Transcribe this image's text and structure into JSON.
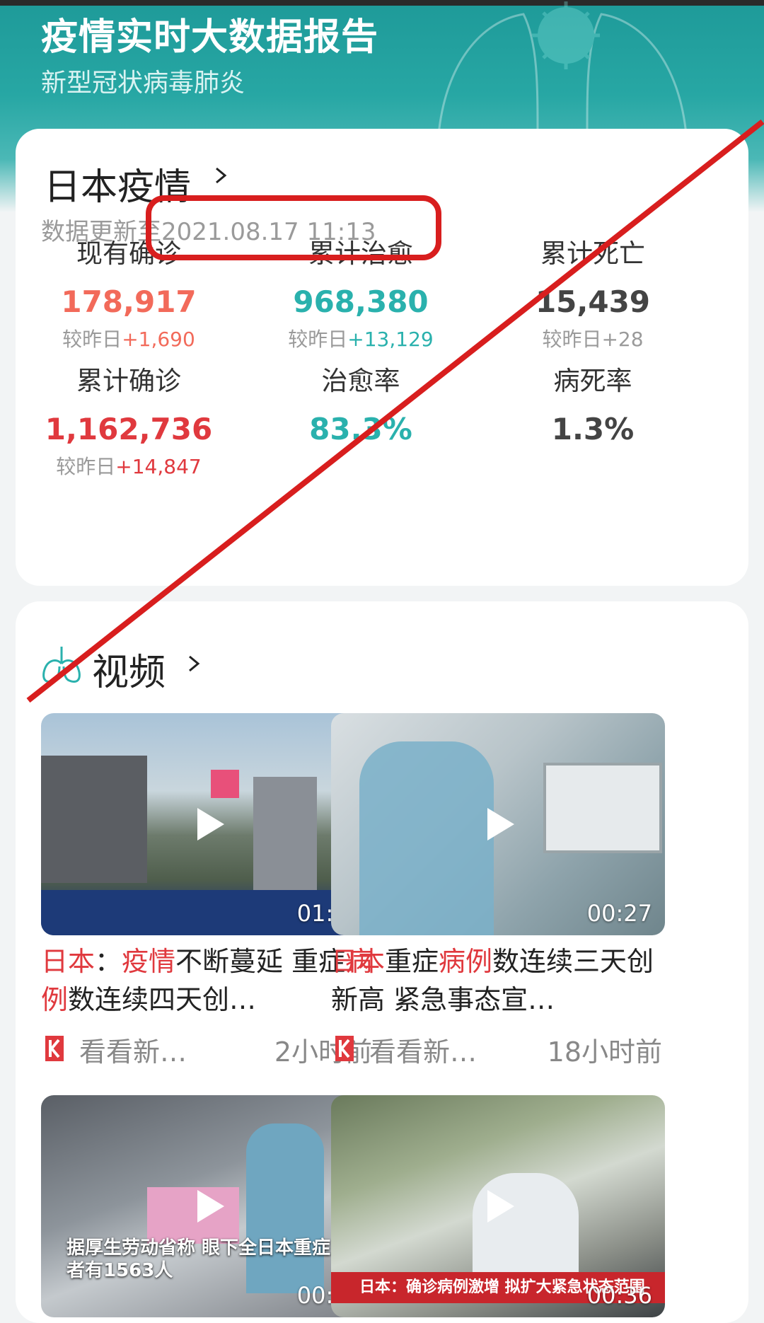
{
  "header": {
    "title": "疫情实时大数据报告",
    "subtitle": "新型冠状病毒肺炎"
  },
  "stats": {
    "title": "日本疫情",
    "update_time": "数据更新至2021.08.17 11:13",
    "items": [
      {
        "label": "现有确诊",
        "value": "178,917",
        "change_prefix": "较昨日",
        "change": "+1,690",
        "value_color": "#f26a5a",
        "change_color": "#f26a5a"
      },
      {
        "label": "累计治愈",
        "value": "968,380",
        "change_prefix": "较昨日",
        "change": "+13,129",
        "value_color": "#2ab1ad",
        "change_color": "#2ab1ad"
      },
      {
        "label": "累计死亡",
        "value": "15,439",
        "change_prefix": "较昨日",
        "change": "+28",
        "value_color": "#444444",
        "change_color": "#9a9a9a"
      },
      {
        "label": "累计确诊",
        "value": "1,162,736",
        "change_prefix": "较昨日",
        "change": "+14,847",
        "value_color": "#e0393e",
        "change_color": "#e0393e"
      },
      {
        "label": "治愈率",
        "value": "83.3%",
        "change_prefix": "",
        "change": "",
        "value_color": "#2ab1ad",
        "change_color": "#9a9a9a"
      },
      {
        "label": "病死率",
        "value": "1.3%",
        "change_prefix": "",
        "change": "",
        "value_color": "#444444",
        "change_color": "#9a9a9a"
      }
    ]
  },
  "videos": {
    "heading": "视频",
    "items": [
      {
        "title_parts": [
          [
            "日本",
            true
          ],
          [
            "：",
            false
          ],
          [
            "疫情",
            true
          ],
          [
            "不断蔓延 重症",
            false
          ],
          [
            "病例",
            true
          ],
          [
            "数连续四天创…",
            false
          ]
        ],
        "duration": "01:02",
        "source": "看看新…",
        "time": "2小时前"
      },
      {
        "title_parts": [
          [
            "日本",
            true
          ],
          [
            "重症",
            false
          ],
          [
            "病例",
            true
          ],
          [
            "数连续三天创新高 紧急事态宣…",
            false
          ]
        ],
        "duration": "00:27",
        "source": "看看新…",
        "time": "18小时前"
      },
      {
        "title_parts": [],
        "duration": "00:30",
        "source": "",
        "time": "",
        "caption": "据厚生劳动省称 眼下全日本重症患者有1563人"
      },
      {
        "title_parts": [],
        "duration": "00:36",
        "source": "",
        "time": "",
        "caption": "日本：确诊病例激增 拟扩大紧急状态范围"
      }
    ]
  },
  "colors": {
    "header_teal": "#1e9a99",
    "accent_red": "#e0393e",
    "accent_teal": "#2ab1ad",
    "annotation_red": "#d81e1e"
  }
}
